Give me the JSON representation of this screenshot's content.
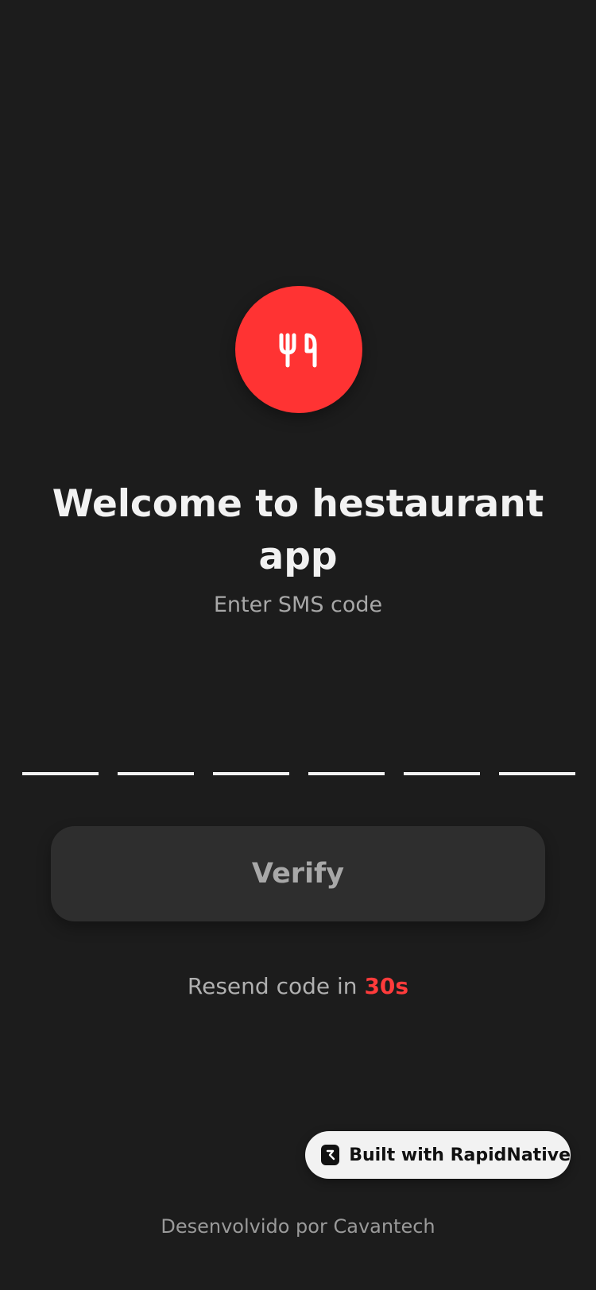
{
  "logo": {
    "icon": "fork-knife-icon",
    "color": "#ff3333"
  },
  "header": {
    "title": "Welcome to hestaurant app",
    "subtitle": "Enter SMS code"
  },
  "code_input": {
    "length": 6,
    "values": [
      "",
      "",
      "",
      "",
      "",
      ""
    ]
  },
  "verify_button": {
    "label": "Verify"
  },
  "resend": {
    "prefix": "Resend code in ",
    "timer": "30s",
    "timer_color": "#ff3b3b"
  },
  "badge": {
    "label": "Built with RapidNative",
    "icon": "rapidnative-logo-icon"
  },
  "footer": {
    "text": "Desenvolvido por Cavantech"
  },
  "colors": {
    "background": "#1c1c1c",
    "accent": "#ff3333",
    "button_bg": "#2e2e2e"
  }
}
